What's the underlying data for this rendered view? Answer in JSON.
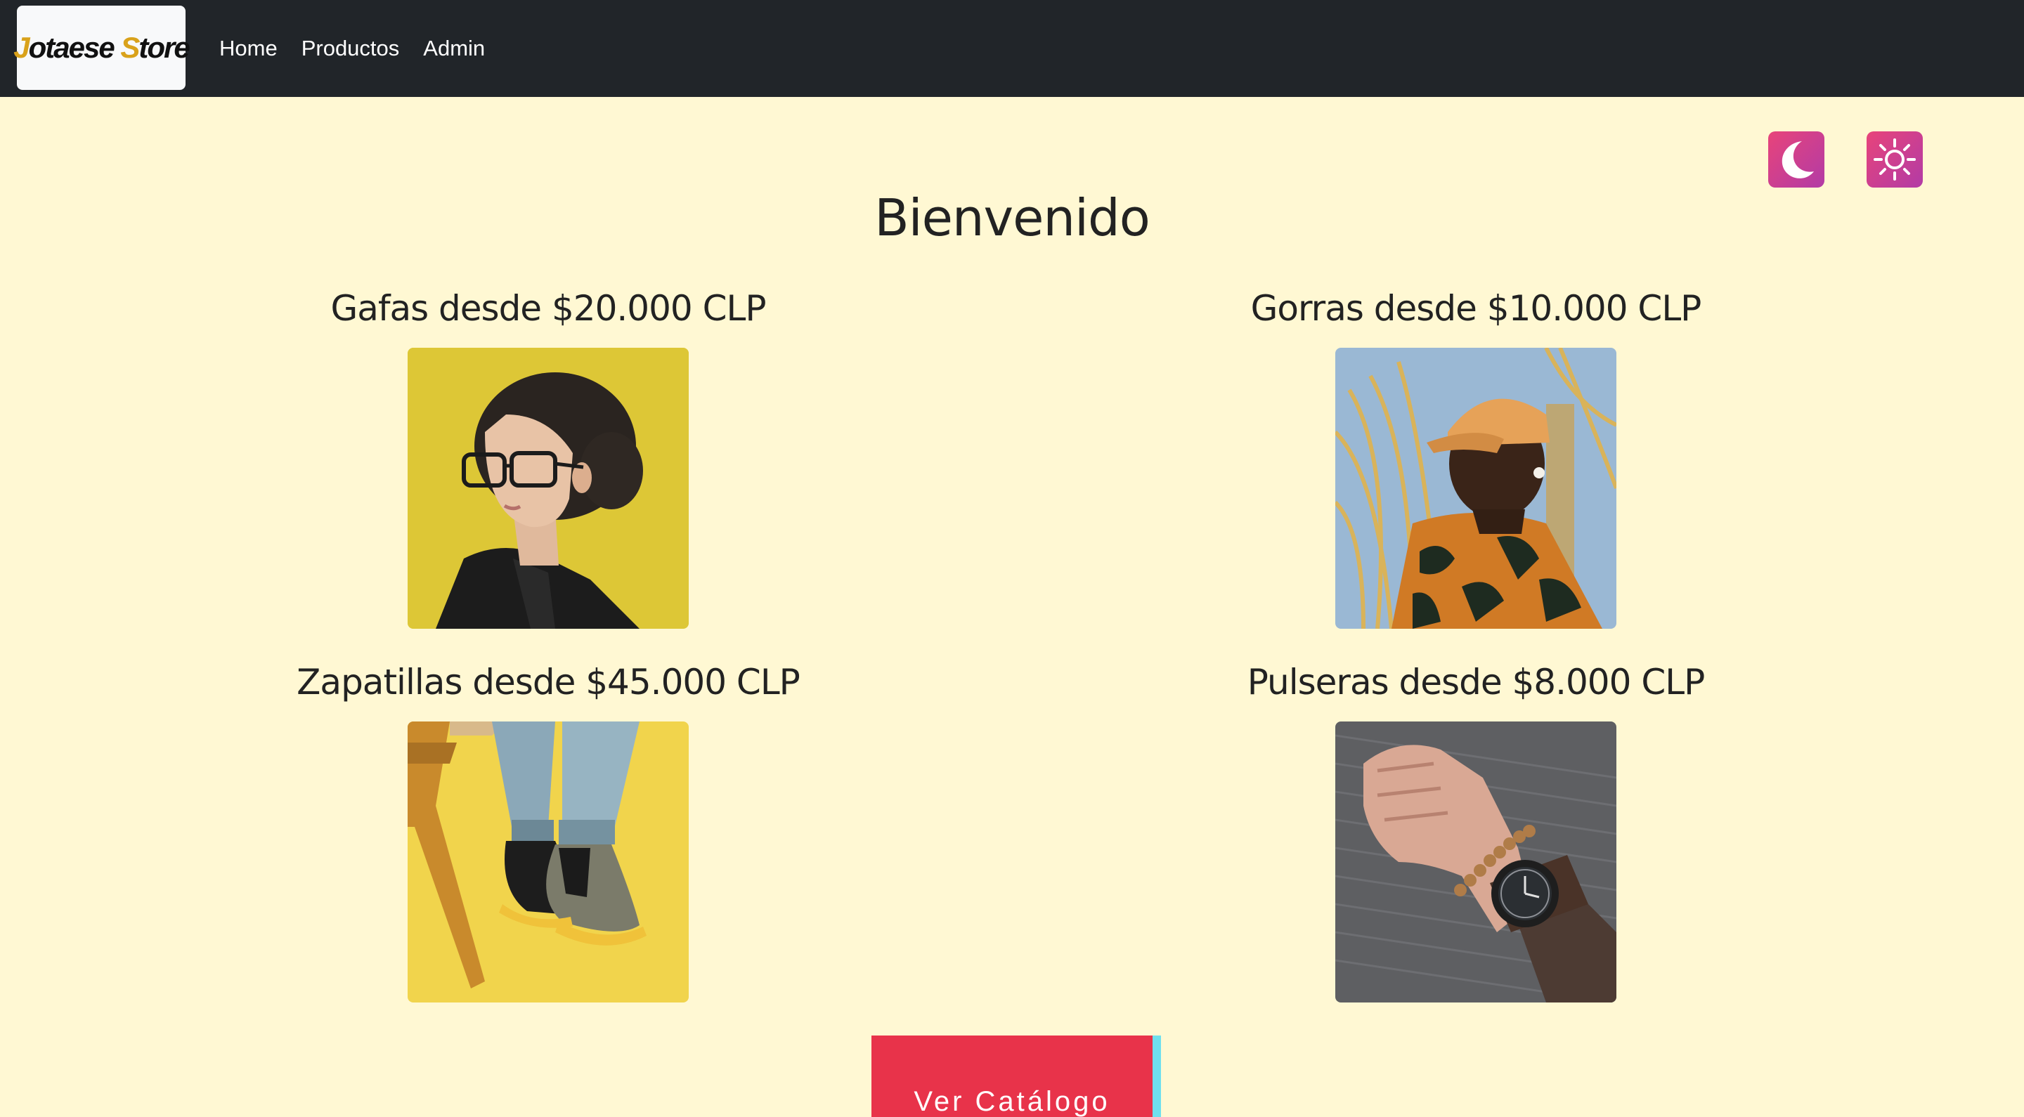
{
  "navbar": {
    "brand": {
      "first_initial": "J",
      "first_rest": "otaese ",
      "second_initial": "S",
      "second_rest": "tore"
    },
    "links": [
      "Home",
      "Productos",
      "Admin"
    ]
  },
  "theme": {
    "dark_icon": "moon-icon",
    "light_icon": "sun-icon"
  },
  "welcome": "Bienvenido",
  "products": [
    {
      "title": "Gafas desde $20.000 CLP",
      "image": "woman-wearing-glasses"
    },
    {
      "title": "Gorras desde $10.000 CLP",
      "image": "man-wearing-cap"
    },
    {
      "title": "Zapatillas desde $45.000 CLP",
      "image": "feet-in-sneakers"
    },
    {
      "title": "Pulseras desde $8.000 CLP",
      "image": "wrist-with-bracelet-and-watch"
    }
  ],
  "catalog_button": "Ver Catálogo",
  "colors": {
    "navbar": "#212529",
    "background": "#fff8d3",
    "button": "#e8334a",
    "accent": "#6fe0ee"
  }
}
